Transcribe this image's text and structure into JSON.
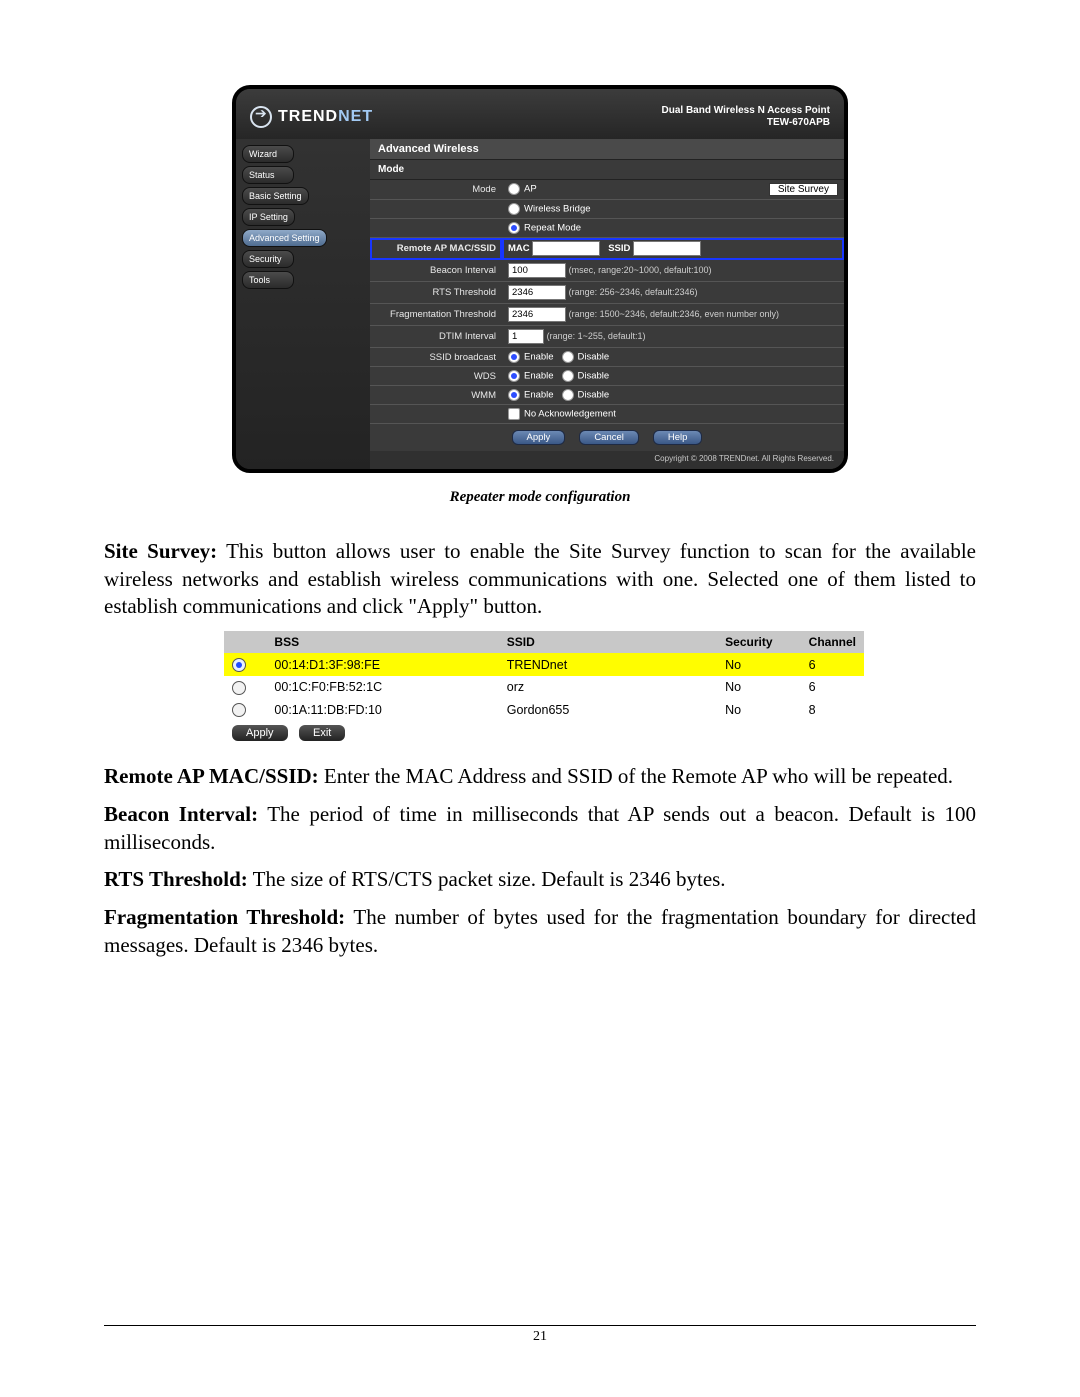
{
  "router": {
    "brand_left": "TREND",
    "brand_right": "NET",
    "product_line": "Dual Band Wireless N Access Point",
    "model": "TEW-670APB",
    "copyright": "Copyright © 2008 TRENDnet. All Rights Reserved.",
    "nav": [
      "Wizard",
      "Status",
      "Basic Setting",
      "IP Setting",
      "Advanced Setting",
      "Security",
      "Tools"
    ],
    "nav_active_index": 4,
    "section_title": "Advanced Wireless",
    "mode_section_title": "Mode",
    "mode_label": "Mode",
    "modes": {
      "ap": "AP",
      "bridge": "Wireless Bridge",
      "repeat": "Repeat Mode"
    },
    "mode_selected": "repeat",
    "site_survey_btn": "Site Survey",
    "remote": {
      "label": "Remote AP MAC/SSID",
      "mac_label": "MAC",
      "mac_value": "",
      "ssid_label": "SSID",
      "ssid_value": ""
    },
    "beacon": {
      "label": "Beacon Interval",
      "value": "100",
      "hint": "(msec, range:20~1000, default:100)"
    },
    "rts": {
      "label": "RTS Threshold",
      "value": "2346",
      "hint": "(range: 256~2346, default:2346)"
    },
    "frag": {
      "label": "Fragmentation Threshold",
      "value": "2346",
      "hint": "(range: 1500~2346, default:2346, even number only)"
    },
    "dtim": {
      "label": "DTIM Interval",
      "value": "1",
      "hint": "(range: 1~255, default:1)"
    },
    "ssid_broadcast": {
      "label": "SSID broadcast",
      "enable": "Enable",
      "disable": "Disable",
      "value": "enable"
    },
    "wds": {
      "label": "WDS",
      "enable": "Enable",
      "disable": "Disable",
      "value": "enable"
    },
    "wmm": {
      "label": "WMM",
      "enable": "Enable",
      "disable": "Disable",
      "value": "enable",
      "noack": "No Acknowledgement",
      "noack_checked": false
    },
    "buttons": {
      "apply": "Apply",
      "cancel": "Cancel",
      "help": "Help"
    }
  },
  "caption": "Repeater mode configuration",
  "paragraphs": {
    "site_survey_label": "Site Survey:",
    "site_survey_text": " This button allows user to enable the Site Survey function to scan for the available wireless networks and establish wireless communications with one. Selected one of them listed to establish communications and click \"Apply\" button.",
    "remote_label": "Remote AP MAC/SSID:",
    "remote_text": " Enter the MAC Address and SSID of the Remote AP who will be repeated.",
    "beacon_label": "Beacon Interval:",
    "beacon_text": " The period of time in milliseconds that AP sends out a beacon. Default is 100 milliseconds.",
    "rts_label": "RTS Threshold:",
    "rts_text": " The size of RTS/CTS packet size. Default is 2346 bytes.",
    "frag_label": "Fragmentation Threshold:",
    "frag_text": " The number of bytes used for the fragmentation boundary for directed messages. Default is 2346 bytes."
  },
  "survey": {
    "headers": [
      "BSS",
      "SSID",
      "Security",
      "Channel"
    ],
    "rows": [
      {
        "selected": true,
        "bss": "00:14:D1:3F:98:FE",
        "ssid": "TRENDnet",
        "security": "No",
        "channel": "6"
      },
      {
        "selected": false,
        "bss": "00:1C:F0:FB:52:1C",
        "ssid": "orz",
        "security": "No",
        "channel": "6"
      },
      {
        "selected": false,
        "bss": "00:1A:11:DB:FD:10",
        "ssid": "Gordon655",
        "security": "No",
        "channel": "8"
      }
    ],
    "apply": "Apply",
    "exit": "Exit"
  },
  "page_number": "21"
}
